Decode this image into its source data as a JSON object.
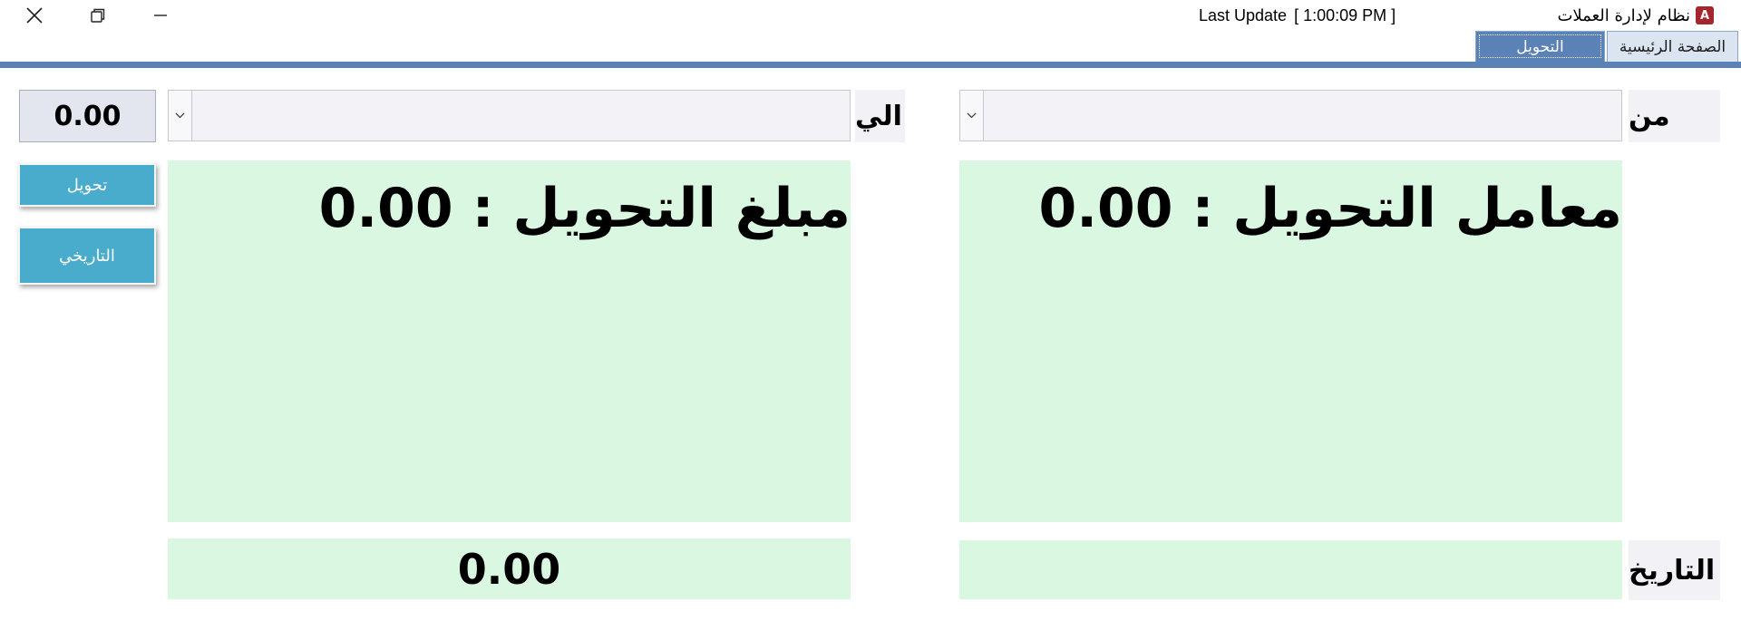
{
  "titlebar": {
    "app_title": "نظام لإدارة العملات",
    "app_logo": "A",
    "last_update_label": "Last Update",
    "last_update_value": "[ 1:00:09 PM ]",
    "icons": [
      "close-icon",
      "restore-icon",
      "minimize-icon",
      "access-logo-icon"
    ]
  },
  "tabs": [
    {
      "label": "الصفحة الرئيسية",
      "active": false
    },
    {
      "label": "التحويل",
      "active": true
    }
  ],
  "form": {
    "from_label": "من",
    "from_value": "",
    "to_label": "الي",
    "to_value": "",
    "total_value": "0.00",
    "convert_button": "تحويل",
    "history_button": "التاريخي",
    "rate_label": "معامل التحويل :",
    "rate_value": "0.00",
    "amount_label": "مبلغ التحويل :",
    "amount_value": "0.00",
    "date_label": "التاريخ",
    "date_value": "",
    "bottom_value": "0.00"
  },
  "colors": {
    "accent": "#5b82b6",
    "panel_green": "#d9f7e1",
    "button_teal": "#4aaccc",
    "label_gray": "#f2f1f5",
    "logo_red": "#a4262c"
  }
}
